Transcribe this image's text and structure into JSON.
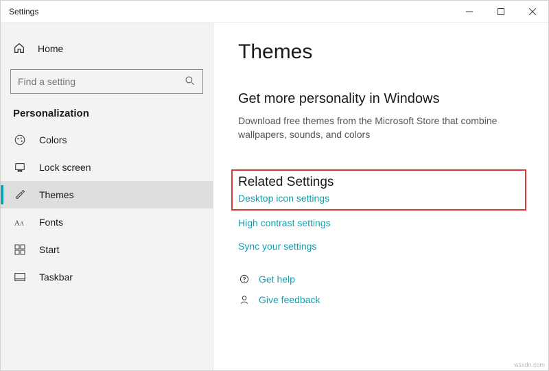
{
  "window": {
    "title": "Settings"
  },
  "sidebar": {
    "home_label": "Home",
    "search_placeholder": "Find a setting",
    "category": "Personalization",
    "items": [
      {
        "label": "Colors",
        "icon": "palette-icon",
        "selected": false
      },
      {
        "label": "Lock screen",
        "icon": "lock-icon",
        "selected": false
      },
      {
        "label": "Themes",
        "icon": "brush-icon",
        "selected": true
      },
      {
        "label": "Fonts",
        "icon": "font-icon",
        "selected": false
      },
      {
        "label": "Start",
        "icon": "start-icon",
        "selected": false
      },
      {
        "label": "Taskbar",
        "icon": "taskbar-icon",
        "selected": false
      }
    ]
  },
  "main": {
    "title": "Themes",
    "more_heading": "Get more personality in Windows",
    "more_sub": "Download free themes from the Microsoft Store that combine wallpapers, sounds, and colors",
    "related_heading": "Related Settings",
    "links": {
      "desktop_icons": "Desktop icon settings",
      "high_contrast": "High contrast settings",
      "sync": "Sync your settings"
    },
    "help": {
      "get_help": "Get help",
      "feedback": "Give feedback"
    }
  },
  "watermark": "wsxdn.com",
  "colors": {
    "accent": "#0aa2b5",
    "highlight_border": "#d93a3a"
  }
}
